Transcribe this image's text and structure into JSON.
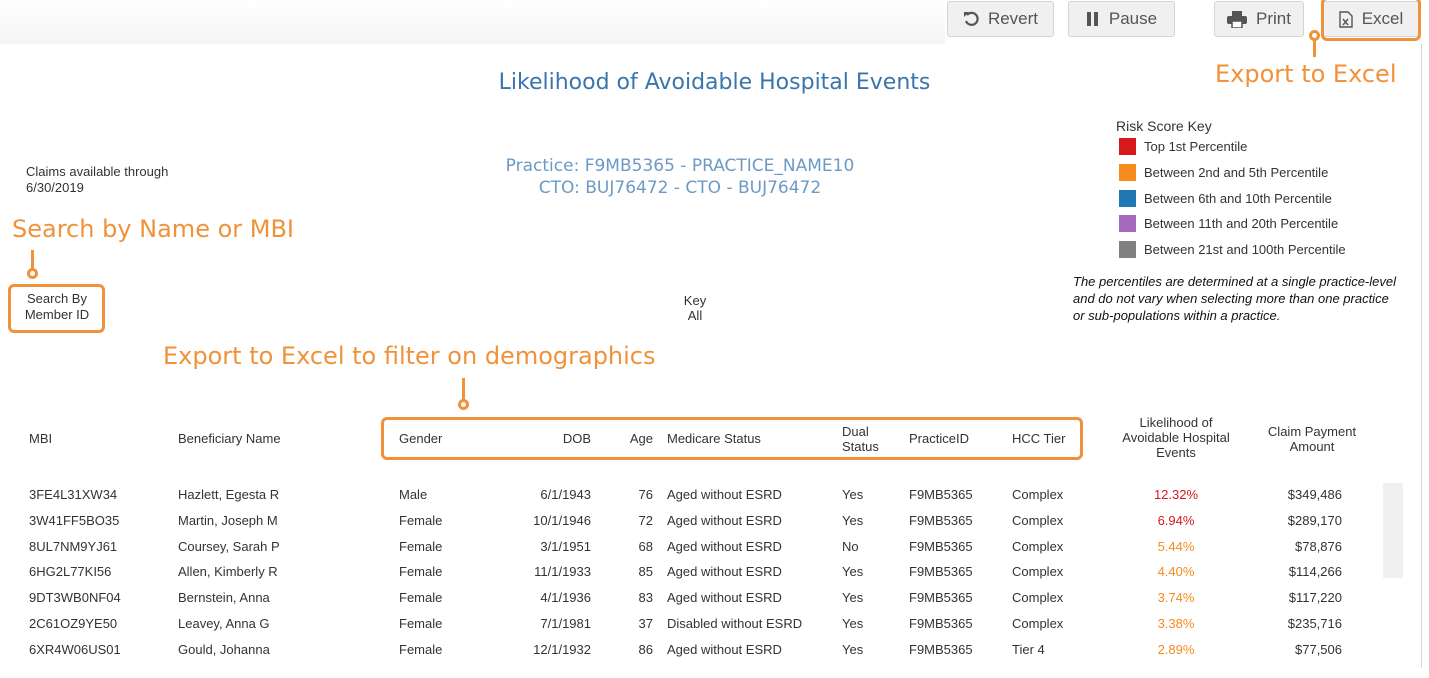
{
  "toolbar": {
    "revert_label": "Revert",
    "pause_label": "Pause",
    "print_label": "Print",
    "excel_label": "Excel"
  },
  "annotations": {
    "export_excel": "Export to Excel",
    "search": "Search by Name or MBI",
    "demographics": "Export to Excel to filter on demographics"
  },
  "report": {
    "title": "Likelihood of Avoidable Hospital Events",
    "practice_line": "Practice: F9MB5365 - PRACTICE_NAME10",
    "cto_line": "CTO: BUJ76472 - CTO - BUJ76472",
    "claims_label": "Claims available through",
    "claims_date": "6/30/2019"
  },
  "filters": {
    "search_label": "Search By",
    "search_value": "Member ID",
    "key_label": "Key",
    "key_value": "All"
  },
  "risk_key": {
    "title": "Risk Score Key",
    "items": [
      {
        "label": "Top 1st Percentile",
        "color": "#d7191c"
      },
      {
        "label": "Between 2nd and 5th Percentile",
        "color": "#f68b1f"
      },
      {
        "label": "Between 6th and 10th Percentile",
        "color": "#1f77b4"
      },
      {
        "label": "Between 11th and 20th Percentile",
        "color": "#a569bd"
      },
      {
        "label": "Between 21st and 100th Percentile",
        "color": "#808080"
      }
    ],
    "note": "The percentiles are determined at a single practice-level and do not vary when selecting more than one practice or sub-populations within a practice."
  },
  "table": {
    "headers": {
      "mbi": "MBI",
      "name": "Beneficiary Name",
      "gender": "Gender",
      "dob": "DOB",
      "age": "Age",
      "medicare": "Medicare Status",
      "dual_1": "Dual",
      "dual_2": "Status",
      "practice": "PracticeID",
      "hcc": "HCC Tier",
      "likelihood_1": "Likelihood of",
      "likelihood_2": "Avoidable Hospital",
      "likelihood_3": "Events",
      "claim_1": "Claim Payment",
      "claim_2": "Amount"
    },
    "rows": [
      {
        "mbi": "3FE4L31XW34",
        "name": "Hazlett, Egesta R",
        "gender": "Male",
        "dob": "6/1/1943",
        "age": "76",
        "medicare": "Aged without ESRD",
        "dual": "Yes",
        "practice": "F9MB5365",
        "hcc": "Complex",
        "likelihood": "12.32%",
        "claim": "$349,486",
        "color": "#d7191c"
      },
      {
        "mbi": "3W41FF5BO35",
        "name": "Martin, Joseph M",
        "gender": "Female",
        "dob": "10/1/1946",
        "age": "72",
        "medicare": "Aged without ESRD",
        "dual": "Yes",
        "practice": "F9MB5365",
        "hcc": "Complex",
        "likelihood": "6.94%",
        "claim": "$289,170",
        "color": "#d7191c"
      },
      {
        "mbi": "8UL7NM9YJ61",
        "name": "Coursey, Sarah P",
        "gender": "Female",
        "dob": "3/1/1951",
        "age": "68",
        "medicare": "Aged without ESRD",
        "dual": "No",
        "practice": "F9MB5365",
        "hcc": "Complex",
        "likelihood": "5.44%",
        "claim": "$78,876",
        "color": "#f68b1f"
      },
      {
        "mbi": "6HG2L77KI56",
        "name": "Allen, Kimberly R",
        "gender": "Female",
        "dob": "11/1/1933",
        "age": "85",
        "medicare": "Aged without ESRD",
        "dual": "Yes",
        "practice": "F9MB5365",
        "hcc": "Complex",
        "likelihood": "4.40%",
        "claim": "$114,266",
        "color": "#f68b1f"
      },
      {
        "mbi": "9DT3WB0NF04",
        "name": "Bernstein, Anna",
        "gender": "Female",
        "dob": "4/1/1936",
        "age": "83",
        "medicare": "Aged without ESRD",
        "dual": "Yes",
        "practice": "F9MB5365",
        "hcc": "Complex",
        "likelihood": "3.74%",
        "claim": "$117,220",
        "color": "#f68b1f"
      },
      {
        "mbi": "2C61OZ9YE50",
        "name": "Leavey, Anna G",
        "gender": "Female",
        "dob": "7/1/1981",
        "age": "37",
        "medicare": "Disabled without ESRD",
        "dual": "Yes",
        "practice": "F9MB5365",
        "hcc": "Complex",
        "likelihood": "3.38%",
        "claim": "$235,716",
        "color": "#f68b1f"
      },
      {
        "mbi": "6XR4W06US01",
        "name": "Gould, Johanna",
        "gender": "Female",
        "dob": "12/1/1932",
        "age": "86",
        "medicare": "Aged without ESRD",
        "dual": "Yes",
        "practice": "F9MB5365",
        "hcc": "Tier 4",
        "likelihood": "2.89%",
        "claim": "$77,506",
        "color": "#f68b1f"
      }
    ]
  }
}
